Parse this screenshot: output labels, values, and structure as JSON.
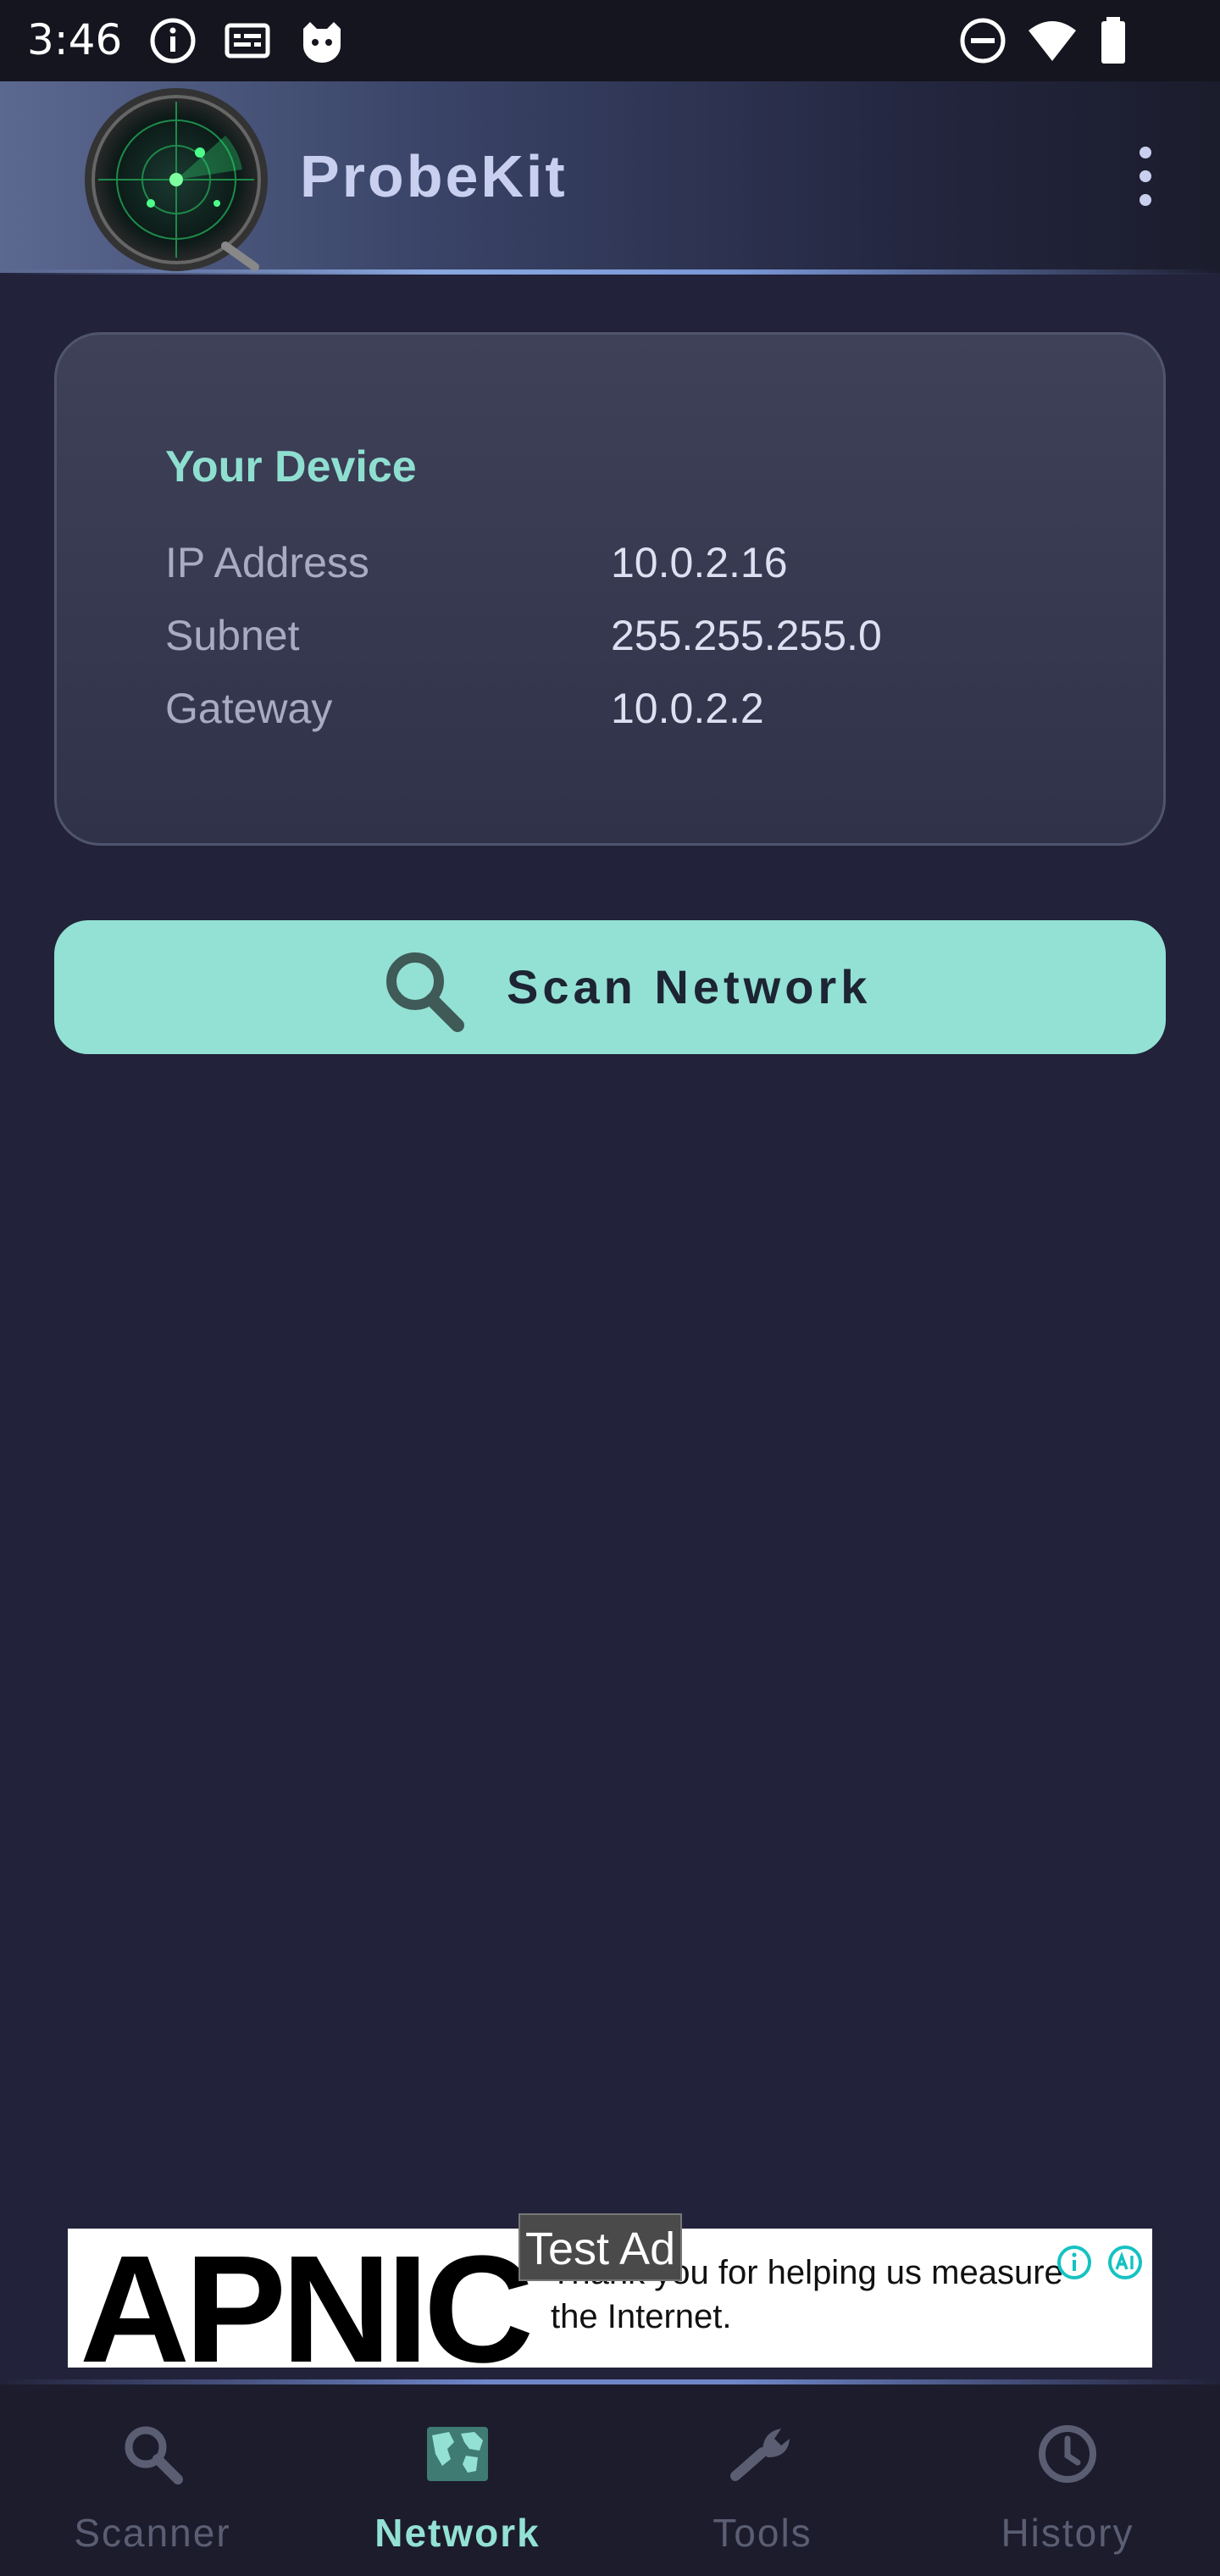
{
  "status_bar": {
    "time": "3:46",
    "left_icons": [
      "info-icon",
      "keyboard-icon",
      "cat-icon"
    ],
    "right_icons": [
      "do-not-disturb-icon",
      "wifi-icon",
      "battery-icon"
    ]
  },
  "app_bar": {
    "title": "ProbeKit",
    "logo_icon": "radar-logo-icon",
    "menu_icon": "overflow-menu-icon"
  },
  "device_card": {
    "title": "Your Device",
    "rows": [
      {
        "label": "IP Address",
        "value": "10.0.2.16"
      },
      {
        "label": "Subnet",
        "value": "255.255.255.0"
      },
      {
        "label": "Gateway",
        "value": "10.0.2.2"
      }
    ]
  },
  "scan_button": {
    "label": "Scan Network",
    "icon": "search-icon"
  },
  "ad": {
    "badge": "Test Ad",
    "logo_text": "APNIC",
    "text": "Thank you for helping us measure the Internet."
  },
  "bottom_nav": {
    "items": [
      {
        "label": "Scanner",
        "icon": "search-icon",
        "active": false
      },
      {
        "label": "Network",
        "icon": "world-map-icon",
        "active": true
      },
      {
        "label": "Tools",
        "icon": "wrench-icon",
        "active": false
      },
      {
        "label": "History",
        "icon": "clock-icon",
        "active": false
      }
    ]
  },
  "colors": {
    "background": "#22223a",
    "accent": "#93e1d4",
    "card": "#3a3d54",
    "nav_inactive": "#5b5e73"
  }
}
